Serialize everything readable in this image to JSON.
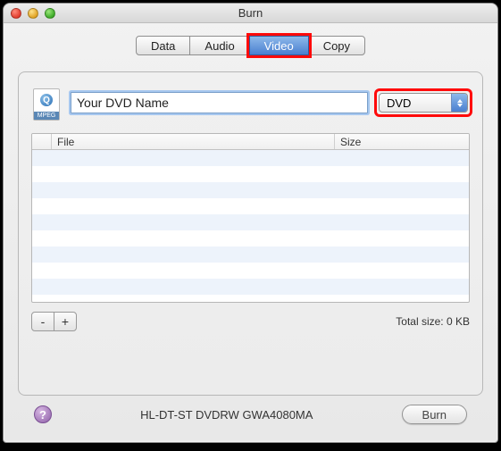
{
  "window": {
    "title": "Burn"
  },
  "tabs": {
    "data": "Data",
    "audio": "Audio",
    "video": "Video",
    "copy": "Copy",
    "selected": "video"
  },
  "name_row": {
    "icon_label": "MPEG",
    "input_value": "Your DVD Name",
    "format": "DVD"
  },
  "table": {
    "columns": {
      "file": "File",
      "size": "Size"
    },
    "rows": []
  },
  "buttons": {
    "remove": "-",
    "add": "+",
    "burn": "Burn"
  },
  "status": {
    "total_size": "Total size: 0 KB",
    "drive": "HL-DT-ST DVDRW GWA4080MA"
  },
  "help": "?"
}
